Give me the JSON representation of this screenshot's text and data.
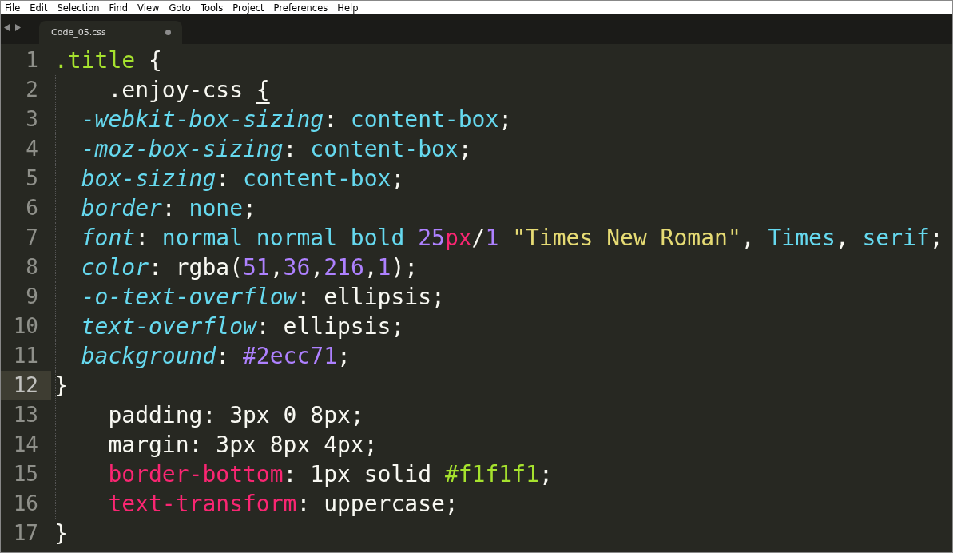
{
  "menu_bar": [
    "File",
    "Edit",
    "Selection",
    "Find",
    "View",
    "Goto",
    "Tools",
    "Project",
    "Preferences",
    "Help"
  ],
  "tabs": [
    {
      "label": "Code_05.css",
      "selected": true,
      "modified": true
    }
  ],
  "editor": {
    "lines": [
      {
        "number": "1",
        "current": false,
        "indented": false,
        "nested": false,
        "tokens": [
          {
            "kind": "selector",
            "text": ".title"
          },
          {
            "kind": "plain",
            "text": " {"
          }
        ]
      },
      {
        "number": "2",
        "current": false,
        "indented": true,
        "nested": true,
        "tokens": [
          {
            "kind": "plain",
            "text": ".enjoy-css "
          },
          {
            "kind": "match",
            "text": "{"
          }
        ]
      },
      {
        "number": "3",
        "current": false,
        "indented": true,
        "nested": false,
        "tokens": [
          {
            "kind": "property",
            "text": "-webkit-box-sizing"
          },
          {
            "kind": "plain",
            "text": ": "
          },
          {
            "kind": "value",
            "text": "content-box"
          },
          {
            "kind": "plain",
            "text": ";"
          }
        ]
      },
      {
        "number": "4",
        "current": false,
        "indented": true,
        "nested": false,
        "tokens": [
          {
            "kind": "property",
            "text": "-moz-box-sizing"
          },
          {
            "kind": "plain",
            "text": ": "
          },
          {
            "kind": "value",
            "text": "content-box"
          },
          {
            "kind": "plain",
            "text": ";"
          }
        ]
      },
      {
        "number": "5",
        "current": false,
        "indented": true,
        "nested": false,
        "tokens": [
          {
            "kind": "property",
            "text": "box-sizing"
          },
          {
            "kind": "plain",
            "text": ": "
          },
          {
            "kind": "value",
            "text": "content-box"
          },
          {
            "kind": "plain",
            "text": ";"
          }
        ]
      },
      {
        "number": "6",
        "current": false,
        "indented": true,
        "nested": false,
        "tokens": [
          {
            "kind": "property",
            "text": "border"
          },
          {
            "kind": "plain",
            "text": ": "
          },
          {
            "kind": "value",
            "text": "none"
          },
          {
            "kind": "plain",
            "text": ";"
          }
        ]
      },
      {
        "number": "7",
        "current": false,
        "indented": true,
        "nested": false,
        "tokens": [
          {
            "kind": "property",
            "text": "font"
          },
          {
            "kind": "plain",
            "text": ": "
          },
          {
            "kind": "value",
            "text": "normal normal bold "
          },
          {
            "kind": "number",
            "text": "25"
          },
          {
            "kind": "keyword",
            "text": "px"
          },
          {
            "kind": "plain",
            "text": "/"
          },
          {
            "kind": "number",
            "text": "1"
          },
          {
            "kind": "string",
            "text": " \"Times New Roman\""
          },
          {
            "kind": "plain",
            "text": ", "
          },
          {
            "kind": "value",
            "text": "Times"
          },
          {
            "kind": "plain",
            "text": ", "
          },
          {
            "kind": "value",
            "text": "serif"
          },
          {
            "kind": "plain",
            "text": ";"
          }
        ]
      },
      {
        "number": "8",
        "current": false,
        "indented": true,
        "nested": false,
        "tokens": [
          {
            "kind": "property",
            "text": "color"
          },
          {
            "kind": "plain",
            "text": ": rgba("
          },
          {
            "kind": "number",
            "text": "51"
          },
          {
            "kind": "plain",
            "text": ","
          },
          {
            "kind": "number",
            "text": "36"
          },
          {
            "kind": "plain",
            "text": ","
          },
          {
            "kind": "number",
            "text": "216"
          },
          {
            "kind": "plain",
            "text": ","
          },
          {
            "kind": "number",
            "text": "1"
          },
          {
            "kind": "plain",
            "text": ");"
          }
        ]
      },
      {
        "number": "9",
        "current": false,
        "indented": true,
        "nested": false,
        "tokens": [
          {
            "kind": "property",
            "text": "-o-text-overflow"
          },
          {
            "kind": "plain",
            "text": ": ellipsis;"
          }
        ]
      },
      {
        "number": "10",
        "current": false,
        "indented": true,
        "nested": false,
        "tokens": [
          {
            "kind": "property",
            "text": "text-overflow"
          },
          {
            "kind": "plain",
            "text": ": ellipsis;"
          }
        ]
      },
      {
        "number": "11",
        "current": false,
        "indented": true,
        "nested": false,
        "tokens": [
          {
            "kind": "property",
            "text": "background"
          },
          {
            "kind": "plain",
            "text": ": "
          },
          {
            "kind": "number",
            "text": "#2ecc71"
          },
          {
            "kind": "plain",
            "text": ";"
          }
        ]
      },
      {
        "number": "12",
        "current": true,
        "indented": false,
        "nested": false,
        "tokens": [
          {
            "kind": "plain",
            "text": "}"
          }
        ]
      },
      {
        "number": "13",
        "current": false,
        "indented": true,
        "nested": true,
        "tokens": [
          {
            "kind": "plain",
            "text": "padding: 3px 0 8px;"
          }
        ]
      },
      {
        "number": "14",
        "current": false,
        "indented": true,
        "nested": true,
        "tokens": [
          {
            "kind": "plain",
            "text": "margin: 3px 8px 4px;"
          }
        ]
      },
      {
        "number": "15",
        "current": false,
        "indented": true,
        "nested": true,
        "tokens": [
          {
            "kind": "keyword",
            "text": "border-bottom"
          },
          {
            "kind": "plain",
            "text": ": 1px solid "
          },
          {
            "kind": "selector",
            "text": "#f1f1f1"
          },
          {
            "kind": "plain",
            "text": ";"
          }
        ]
      },
      {
        "number": "16",
        "current": false,
        "indented": true,
        "nested": true,
        "tokens": [
          {
            "kind": "keyword",
            "text": "text-transform"
          },
          {
            "kind": "plain",
            "text": ": uppercase;"
          }
        ]
      },
      {
        "number": "17",
        "current": false,
        "indented": false,
        "nested": false,
        "tokens": [
          {
            "kind": "plain",
            "text": "}"
          }
        ]
      }
    ]
  }
}
